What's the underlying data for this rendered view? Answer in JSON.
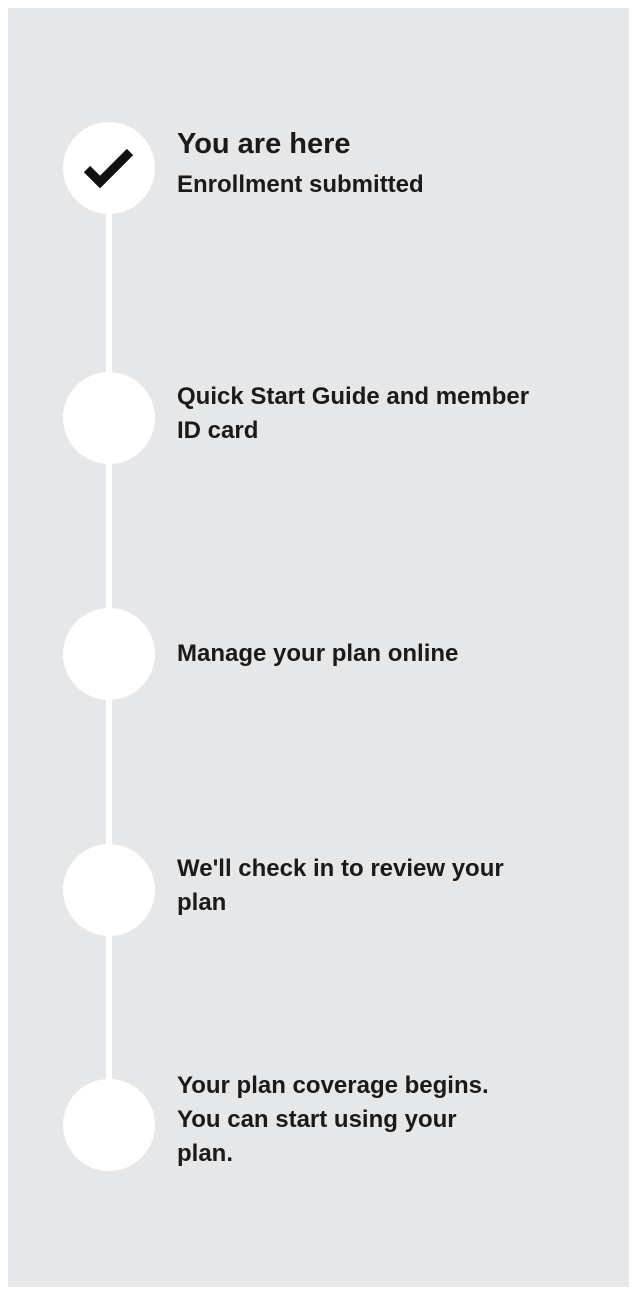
{
  "progress": {
    "current_heading": "You are here",
    "steps": [
      {
        "label": "Enrollment submitted",
        "status": "complete",
        "icon": "checkmark-icon"
      },
      {
        "label": "Quick Start Guide and member ID card",
        "status": "upcoming"
      },
      {
        "label": "Manage your plan online",
        "status": "upcoming"
      },
      {
        "label": "We'll check in to review your plan",
        "status": "upcoming"
      },
      {
        "label": "Your plan coverage begins. You can start using your plan.",
        "status": "upcoming"
      }
    ]
  },
  "colors": {
    "panel_background": "#e6e7e8",
    "marker": "#ffffff",
    "text": "#1a1a1a"
  }
}
